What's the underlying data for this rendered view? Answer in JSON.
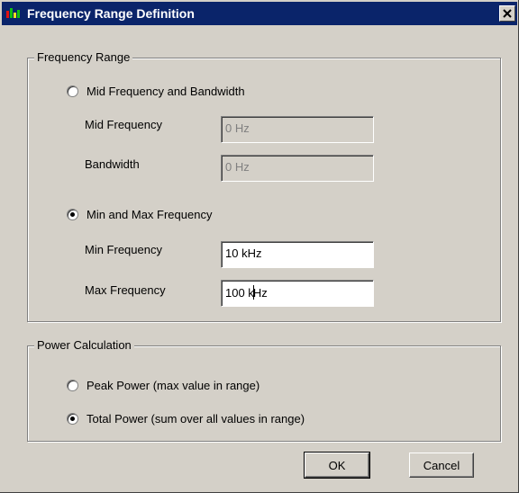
{
  "window": {
    "title": "Frequency Range Definition",
    "close_glyph": "✕",
    "title_bar_color": "#0a246a",
    "face_color": "#d4d0c8"
  },
  "frequency_range": {
    "group_label": "Frequency Range",
    "option_mid_bandwidth": {
      "label": "Mid Frequency and Bandwidth",
      "checked": false
    },
    "mid_frequency": {
      "label": "Mid Frequency",
      "value": "0 Hz",
      "enabled": false
    },
    "bandwidth": {
      "label": "Bandwidth",
      "value": "0 Hz",
      "enabled": false
    },
    "option_min_max": {
      "label": "Min and Max Frequency",
      "checked": true
    },
    "min_frequency": {
      "label": "Min Frequency",
      "value": "10 kHz",
      "enabled": true
    },
    "max_frequency": {
      "label": "Max Frequency",
      "value": "100 kHz",
      "value_before_cursor": "100 k",
      "value_after_cursor": "Hz",
      "enabled": true
    }
  },
  "power_calculation": {
    "group_label": "Power Calculation",
    "option_peak": {
      "label": "Peak Power (max value in range)",
      "checked": false
    },
    "option_total": {
      "label": "Total Power (sum over all values in range)",
      "checked": true
    }
  },
  "buttons": {
    "ok_label": "OK",
    "cancel_label": "Cancel"
  },
  "icons": {
    "title": "app-icon",
    "close": "close-icon",
    "radio": "radio-button"
  }
}
